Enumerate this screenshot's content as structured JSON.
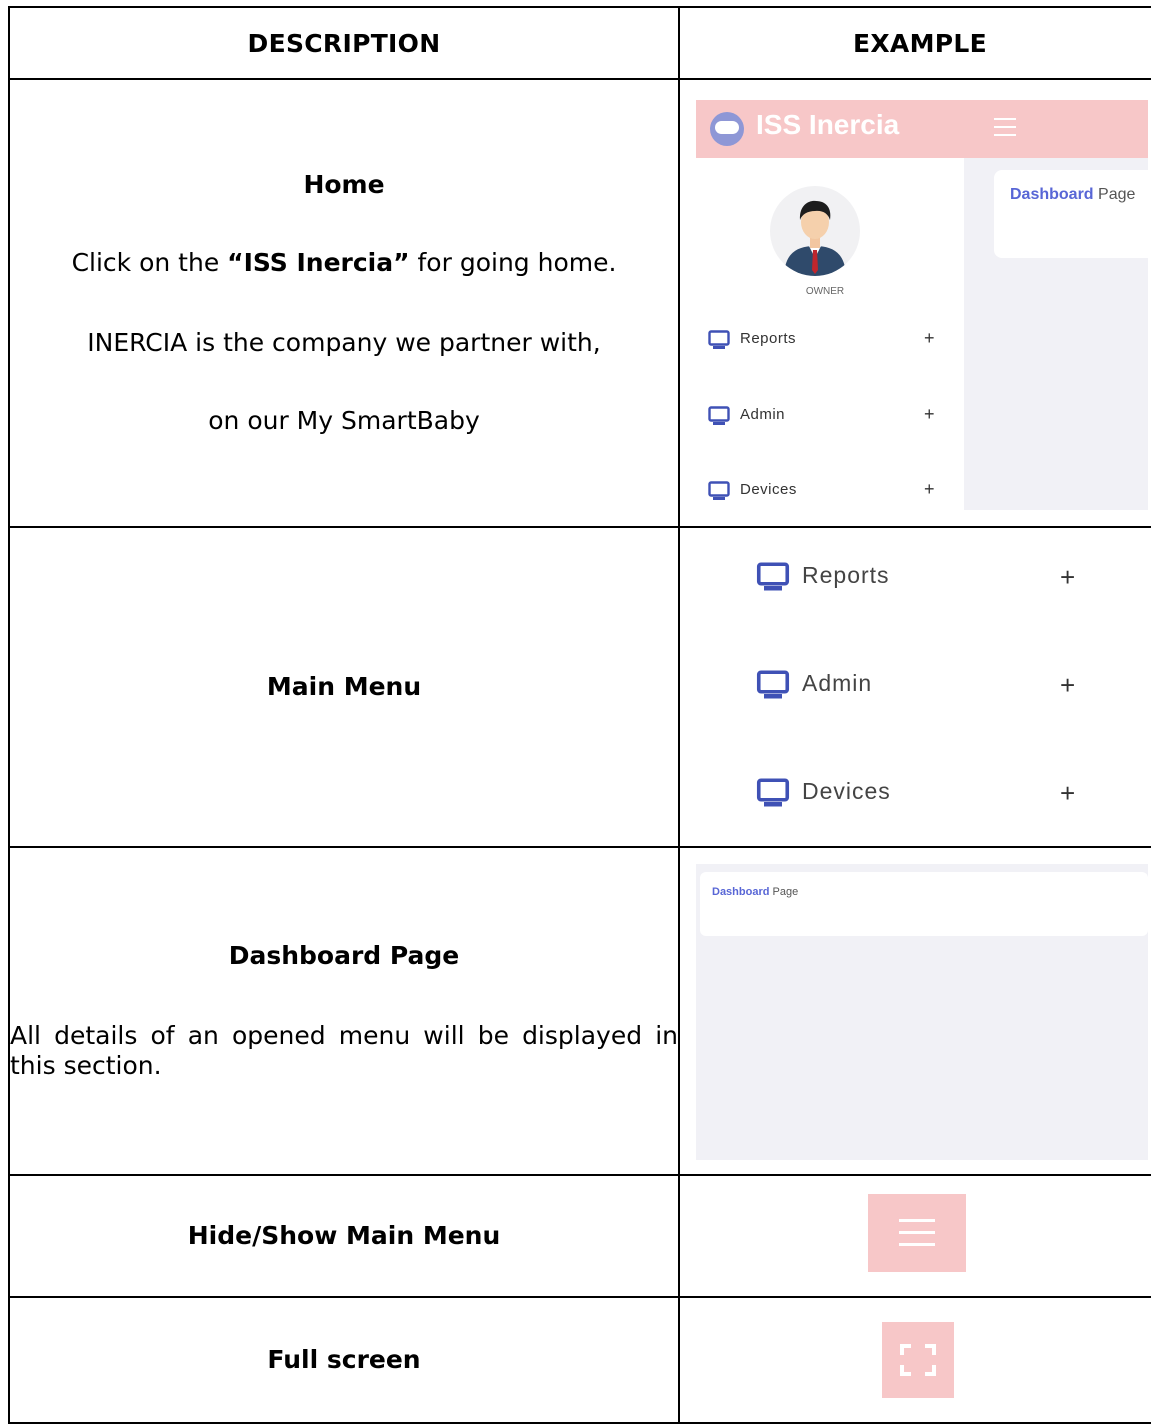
{
  "header": {
    "description": "DESCRIPTION",
    "example": "EXAMPLE"
  },
  "rows": [
    {
      "title": "Home",
      "line1_pre": "Click on the ",
      "line1_bold": "“ISS Inercia”",
      "line1_post": " for going home.",
      "line2": "INERCIA is the company we partner with,",
      "line3": "on our My SmartBaby"
    },
    {
      "title": "Main Menu"
    },
    {
      "title": "Dashboard Page",
      "body": "All details of an opened menu will be displayed in this section."
    },
    {
      "title": "Hide/Show Main Menu"
    },
    {
      "title": "Full screen"
    }
  ],
  "app": {
    "brand": "ISS Inercia",
    "role": "OWNER",
    "menu": [
      {
        "label": "Reports",
        "expand": "+"
      },
      {
        "label": "Admin",
        "expand": "+"
      },
      {
        "label": "Devices",
        "expand": "+"
      }
    ],
    "breadcrumb_bold": "Dashboard",
    "breadcrumb_rest": "Page"
  },
  "colors": {
    "topbar": "#f7c7c8",
    "accent": "#5866d6",
    "monitor_icon": "#3f51b5",
    "content_bg": "#f1f1f6"
  }
}
